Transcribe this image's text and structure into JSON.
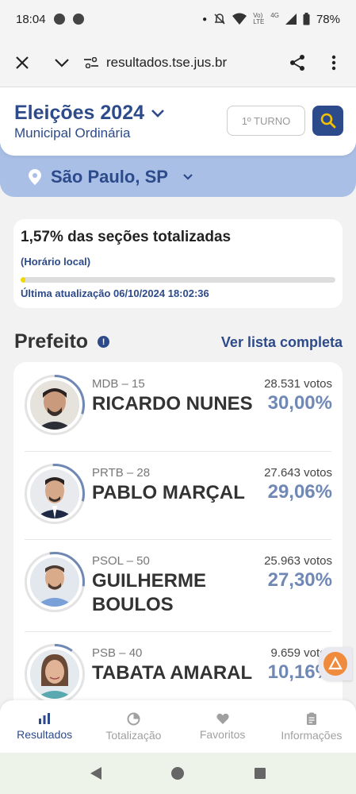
{
  "status": {
    "time": "18:04",
    "network_top": "Vo)",
    "network_bottom": "LTE",
    "signal_label": "4G",
    "battery": "78%"
  },
  "browser": {
    "url": "resultados.tse.jus.br"
  },
  "header": {
    "title": "Eleições 2024",
    "subtitle": "Municipal Ordinária",
    "turno": "1º TURNO"
  },
  "location": {
    "name": "São Paulo, SP"
  },
  "progress": {
    "title": "1,57% das seções totalizadas",
    "local_time": "(Horário local)",
    "fraction": 0.0157,
    "fill_color": "#f2d800",
    "updated": "Última atualização 06/10/2024 18:02:36"
  },
  "section": {
    "title": "Prefeito",
    "info": "!",
    "see_all": "Ver lista completa"
  },
  "candidates": [
    {
      "party": "MDB – 15",
      "name": "RICARDO NUNES",
      "votes": "28.531 votos",
      "percent": "30,00%"
    },
    {
      "party": "PRTB – 28",
      "name": "PABLO MARÇAL",
      "votes": "27.643 votos",
      "percent": "29,06%"
    },
    {
      "party": "PSOL – 50",
      "name": "GUILHERME BOULOS",
      "votes": "25.963 votos",
      "percent": "27,30%"
    },
    {
      "party": "PSB – 40",
      "name": "TABATA AMARAL",
      "votes": "9.659 votos",
      "percent": "10,16%"
    }
  ],
  "nav": [
    {
      "label": "Resultados",
      "icon": "bar-chart-icon"
    },
    {
      "label": "Totalização",
      "icon": "pie-chart-icon"
    },
    {
      "label": "Favoritos",
      "icon": "heart-icon"
    },
    {
      "label": "Informações",
      "icon": "clipboard-icon"
    }
  ],
  "colors": {
    "brand": "#2d4a8a",
    "band": "#a9bfe6",
    "percent": "#7088b4",
    "arc": "#7088b4"
  }
}
